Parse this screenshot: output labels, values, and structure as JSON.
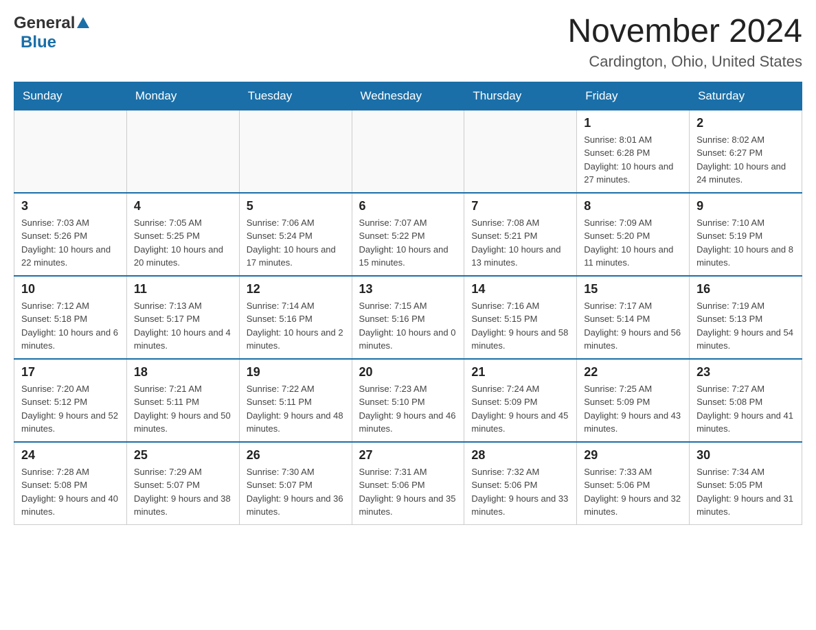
{
  "logo": {
    "general": "General",
    "blue": "Blue"
  },
  "title": "November 2024",
  "subtitle": "Cardington, Ohio, United States",
  "days_of_week": [
    "Sunday",
    "Monday",
    "Tuesday",
    "Wednesday",
    "Thursday",
    "Friday",
    "Saturday"
  ],
  "weeks": [
    [
      {
        "day": "",
        "sunrise": "",
        "sunset": "",
        "daylight": ""
      },
      {
        "day": "",
        "sunrise": "",
        "sunset": "",
        "daylight": ""
      },
      {
        "day": "",
        "sunrise": "",
        "sunset": "",
        "daylight": ""
      },
      {
        "day": "",
        "sunrise": "",
        "sunset": "",
        "daylight": ""
      },
      {
        "day": "",
        "sunrise": "",
        "sunset": "",
        "daylight": ""
      },
      {
        "day": "1",
        "sunrise": "Sunrise: 8:01 AM",
        "sunset": "Sunset: 6:28 PM",
        "daylight": "Daylight: 10 hours and 27 minutes."
      },
      {
        "day": "2",
        "sunrise": "Sunrise: 8:02 AM",
        "sunset": "Sunset: 6:27 PM",
        "daylight": "Daylight: 10 hours and 24 minutes."
      }
    ],
    [
      {
        "day": "3",
        "sunrise": "Sunrise: 7:03 AM",
        "sunset": "Sunset: 5:26 PM",
        "daylight": "Daylight: 10 hours and 22 minutes."
      },
      {
        "day": "4",
        "sunrise": "Sunrise: 7:05 AM",
        "sunset": "Sunset: 5:25 PM",
        "daylight": "Daylight: 10 hours and 20 minutes."
      },
      {
        "day": "5",
        "sunrise": "Sunrise: 7:06 AM",
        "sunset": "Sunset: 5:24 PM",
        "daylight": "Daylight: 10 hours and 17 minutes."
      },
      {
        "day": "6",
        "sunrise": "Sunrise: 7:07 AM",
        "sunset": "Sunset: 5:22 PM",
        "daylight": "Daylight: 10 hours and 15 minutes."
      },
      {
        "day": "7",
        "sunrise": "Sunrise: 7:08 AM",
        "sunset": "Sunset: 5:21 PM",
        "daylight": "Daylight: 10 hours and 13 minutes."
      },
      {
        "day": "8",
        "sunrise": "Sunrise: 7:09 AM",
        "sunset": "Sunset: 5:20 PM",
        "daylight": "Daylight: 10 hours and 11 minutes."
      },
      {
        "day": "9",
        "sunrise": "Sunrise: 7:10 AM",
        "sunset": "Sunset: 5:19 PM",
        "daylight": "Daylight: 10 hours and 8 minutes."
      }
    ],
    [
      {
        "day": "10",
        "sunrise": "Sunrise: 7:12 AM",
        "sunset": "Sunset: 5:18 PM",
        "daylight": "Daylight: 10 hours and 6 minutes."
      },
      {
        "day": "11",
        "sunrise": "Sunrise: 7:13 AM",
        "sunset": "Sunset: 5:17 PM",
        "daylight": "Daylight: 10 hours and 4 minutes."
      },
      {
        "day": "12",
        "sunrise": "Sunrise: 7:14 AM",
        "sunset": "Sunset: 5:16 PM",
        "daylight": "Daylight: 10 hours and 2 minutes."
      },
      {
        "day": "13",
        "sunrise": "Sunrise: 7:15 AM",
        "sunset": "Sunset: 5:16 PM",
        "daylight": "Daylight: 10 hours and 0 minutes."
      },
      {
        "day": "14",
        "sunrise": "Sunrise: 7:16 AM",
        "sunset": "Sunset: 5:15 PM",
        "daylight": "Daylight: 9 hours and 58 minutes."
      },
      {
        "day": "15",
        "sunrise": "Sunrise: 7:17 AM",
        "sunset": "Sunset: 5:14 PM",
        "daylight": "Daylight: 9 hours and 56 minutes."
      },
      {
        "day": "16",
        "sunrise": "Sunrise: 7:19 AM",
        "sunset": "Sunset: 5:13 PM",
        "daylight": "Daylight: 9 hours and 54 minutes."
      }
    ],
    [
      {
        "day": "17",
        "sunrise": "Sunrise: 7:20 AM",
        "sunset": "Sunset: 5:12 PM",
        "daylight": "Daylight: 9 hours and 52 minutes."
      },
      {
        "day": "18",
        "sunrise": "Sunrise: 7:21 AM",
        "sunset": "Sunset: 5:11 PM",
        "daylight": "Daylight: 9 hours and 50 minutes."
      },
      {
        "day": "19",
        "sunrise": "Sunrise: 7:22 AM",
        "sunset": "Sunset: 5:11 PM",
        "daylight": "Daylight: 9 hours and 48 minutes."
      },
      {
        "day": "20",
        "sunrise": "Sunrise: 7:23 AM",
        "sunset": "Sunset: 5:10 PM",
        "daylight": "Daylight: 9 hours and 46 minutes."
      },
      {
        "day": "21",
        "sunrise": "Sunrise: 7:24 AM",
        "sunset": "Sunset: 5:09 PM",
        "daylight": "Daylight: 9 hours and 45 minutes."
      },
      {
        "day": "22",
        "sunrise": "Sunrise: 7:25 AM",
        "sunset": "Sunset: 5:09 PM",
        "daylight": "Daylight: 9 hours and 43 minutes."
      },
      {
        "day": "23",
        "sunrise": "Sunrise: 7:27 AM",
        "sunset": "Sunset: 5:08 PM",
        "daylight": "Daylight: 9 hours and 41 minutes."
      }
    ],
    [
      {
        "day": "24",
        "sunrise": "Sunrise: 7:28 AM",
        "sunset": "Sunset: 5:08 PM",
        "daylight": "Daylight: 9 hours and 40 minutes."
      },
      {
        "day": "25",
        "sunrise": "Sunrise: 7:29 AM",
        "sunset": "Sunset: 5:07 PM",
        "daylight": "Daylight: 9 hours and 38 minutes."
      },
      {
        "day": "26",
        "sunrise": "Sunrise: 7:30 AM",
        "sunset": "Sunset: 5:07 PM",
        "daylight": "Daylight: 9 hours and 36 minutes."
      },
      {
        "day": "27",
        "sunrise": "Sunrise: 7:31 AM",
        "sunset": "Sunset: 5:06 PM",
        "daylight": "Daylight: 9 hours and 35 minutes."
      },
      {
        "day": "28",
        "sunrise": "Sunrise: 7:32 AM",
        "sunset": "Sunset: 5:06 PM",
        "daylight": "Daylight: 9 hours and 33 minutes."
      },
      {
        "day": "29",
        "sunrise": "Sunrise: 7:33 AM",
        "sunset": "Sunset: 5:06 PM",
        "daylight": "Daylight: 9 hours and 32 minutes."
      },
      {
        "day": "30",
        "sunrise": "Sunrise: 7:34 AM",
        "sunset": "Sunset: 5:05 PM",
        "daylight": "Daylight: 9 hours and 31 minutes."
      }
    ]
  ]
}
